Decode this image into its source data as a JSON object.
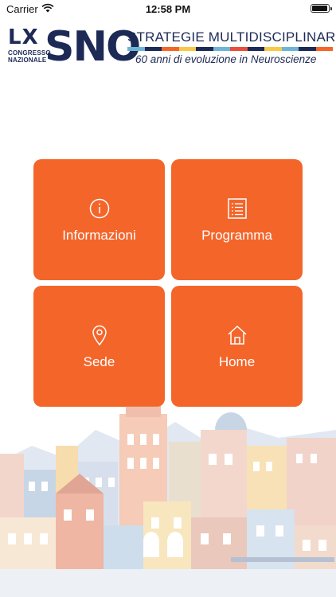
{
  "status_bar": {
    "carrier": "Carrier",
    "time": "12:58 PM"
  },
  "header": {
    "logo_lx": "LX",
    "logo_congresso": "CONGRESSO",
    "logo_nazionale": "NAZIONALE",
    "logo_sno": "SNO",
    "title": "STRATEGIE MULTIDISCIPLINARI",
    "subtitle": "60 anni di evoluzione in Neuroscienze",
    "stripe_colors": [
      "#6fb4d6",
      "#1d2a56",
      "#f4652a",
      "#f7c948",
      "#1d2a56",
      "#6fb4d6",
      "#e94e3c",
      "#1d2a56",
      "#f7c948",
      "#6fb4d6",
      "#1d2a56",
      "#f4652a"
    ]
  },
  "menu": {
    "tiles": [
      {
        "label": "Informazioni",
        "icon": "info-icon"
      },
      {
        "label": "Programma",
        "icon": "list-icon"
      },
      {
        "label": "Sede",
        "icon": "location-pin-icon"
      },
      {
        "label": "Home",
        "icon": "home-icon"
      }
    ]
  },
  "colors": {
    "tile": "#f4652a",
    "brand_navy": "#1d2a56"
  }
}
